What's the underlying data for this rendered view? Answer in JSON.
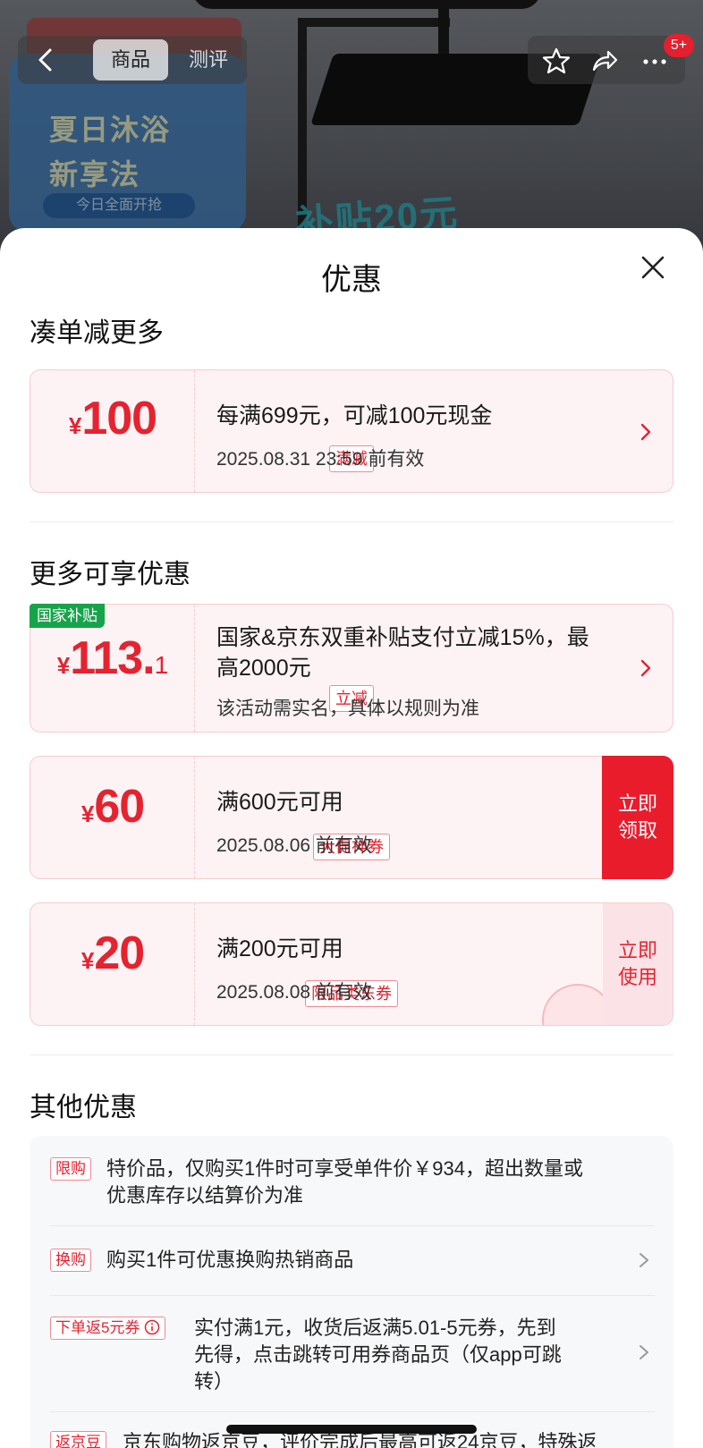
{
  "background": {
    "promo_line1": "夏日沐浴",
    "promo_line2": "新享法",
    "promo_line3": "今日全面开抢",
    "promo_green": "补贴20元"
  },
  "topbar": {
    "tab_product": "商品",
    "tab_review": "测评",
    "more_badge": "5+"
  },
  "sheet": {
    "title": "优惠",
    "section1_title": "凑单减更多",
    "section2_title": "更多可享优惠",
    "section3_title": "其他优惠"
  },
  "coupons": [
    {
      "yen": "¥",
      "amount": "100",
      "tag": "满减",
      "line1": "每满699元，可减100元现金",
      "line2": "2025.08.31 23:59 前有效"
    },
    {
      "badge": "国家补贴",
      "yen": "¥",
      "amount": "113.",
      "decimal": "1",
      "tag": "立减",
      "line1a": "国家&京东双重补贴支付立减15%，最",
      "line1b": "高2000元",
      "line2": "该活动需实名，具体以规则为准"
    },
    {
      "yen": "¥",
      "amount": "60",
      "tag": "大促神券",
      "line1": "满600元可用",
      "line2": "2025.08.06 前有效",
      "button_l1": "立即",
      "button_l2": "领取"
    },
    {
      "yen": "¥",
      "amount": "20",
      "tag": "限品类东券",
      "line1": "满200元可用",
      "line2": "2025.08.08 前有效",
      "button_l1": "立即",
      "button_l2": "使用"
    }
  ],
  "other_offers": [
    {
      "tag": "限购",
      "text_l1": "特价品，仅购买1件时可享受单件价￥934，超出数量或",
      "text_l2": "优惠库存以结算价为准"
    },
    {
      "tag": "换购",
      "text_l1": "购买1件可优惠换购热销商品"
    },
    {
      "tag": "下单返5元券",
      "text_l1": "实付满1元，收货后返满5.01-5元券，先到",
      "text_l2": "先得，点击跳转可用券商品页（仅app可跳",
      "text_l3": "转）"
    },
    {
      "tag": "返京豆",
      "text_l1": "京东购物返京豆，评价完成后最高可返24京豆，特殊返"
    }
  ],
  "colors": {
    "accent_red": "#e52330",
    "button_red": "#e91c2c",
    "coupon_bg": "#fdf3f4",
    "national_green": "#16a34a"
  }
}
